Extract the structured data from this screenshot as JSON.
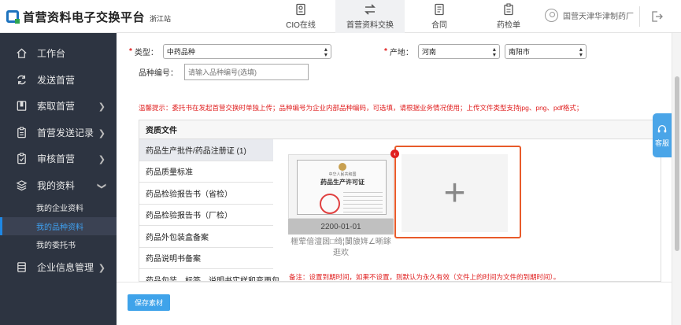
{
  "header": {
    "logo_title": "首营资料电子交换平台",
    "logo_sub": "浙江站",
    "nav": [
      {
        "label": "CIO在线",
        "icon": "card-icon"
      },
      {
        "label": "首营资料交换",
        "icon": "exchange-icon"
      },
      {
        "label": "合同",
        "icon": "document-icon"
      },
      {
        "label": "药检单",
        "icon": "clipboard-icon"
      }
    ],
    "active_nav": 1,
    "user_name": "国营天津华津制药厂"
  },
  "sidebar": {
    "items": [
      {
        "label": "工作台",
        "icon": "home-icon"
      },
      {
        "label": "发送首营",
        "icon": "refresh-icon"
      },
      {
        "label": "索取首营",
        "icon": "bookmark-icon"
      },
      {
        "label": "首营发送记录",
        "icon": "clipboard-icon"
      },
      {
        "label": "审核首营",
        "icon": "clipboard-check-icon"
      },
      {
        "label": "我的资料",
        "icon": "layers-icon"
      },
      {
        "label": "企业信息管理",
        "icon": "database-icon"
      }
    ],
    "sub_items": [
      "我的企业资料",
      "我的品种资料",
      "我的委托书"
    ],
    "active_sub": 1
  },
  "form": {
    "type_label": "类型：",
    "type_value": "中药品种",
    "origin_label": "产地：",
    "province_value": "河南",
    "city_value": "南阳市",
    "code_label": "品种编号：",
    "code_placeholder": "请输入品种编号(选填)"
  },
  "tip": "温馨提示：委托书在发起首营交换时单独上传；品种编号为企业内部品种编码，可选填，请根据业务情况使用；上传文件类型支持jpg、png、pdf格式；",
  "panel": {
    "title": "资质文件",
    "docs": [
      "药品生产批件/药品注册证 (1)",
      "药品质量标准",
      "药品检验报告书（省检）",
      "药品检验报告书（厂检）",
      "药品外包装盒备案",
      "药品说明书备案",
      "药品包装、标签、说明书实样和变更包"
    ],
    "active_doc": 0
  },
  "upload": {
    "cert_top": "中华人民共和国",
    "cert_title": "药品生产许可证",
    "date": "2200-01-01",
    "garbled_name": "榧荤偣澶囦□绮¦闅旇姩∠晰鎵逛欢",
    "close_glyph": "‹",
    "plus_glyph": "+"
  },
  "note": "备注：设置到期时间，如果不设置，则默认为永久有效（文件上的时间为文件的到期时间）。",
  "footer": {
    "save_label": "保存素材"
  },
  "kefu_label": "客服",
  "colors": {
    "accent": "#3fa3ea",
    "sidebar_bg": "#2d3441",
    "warning": "#e02020",
    "highlight": "#e85a2a"
  }
}
